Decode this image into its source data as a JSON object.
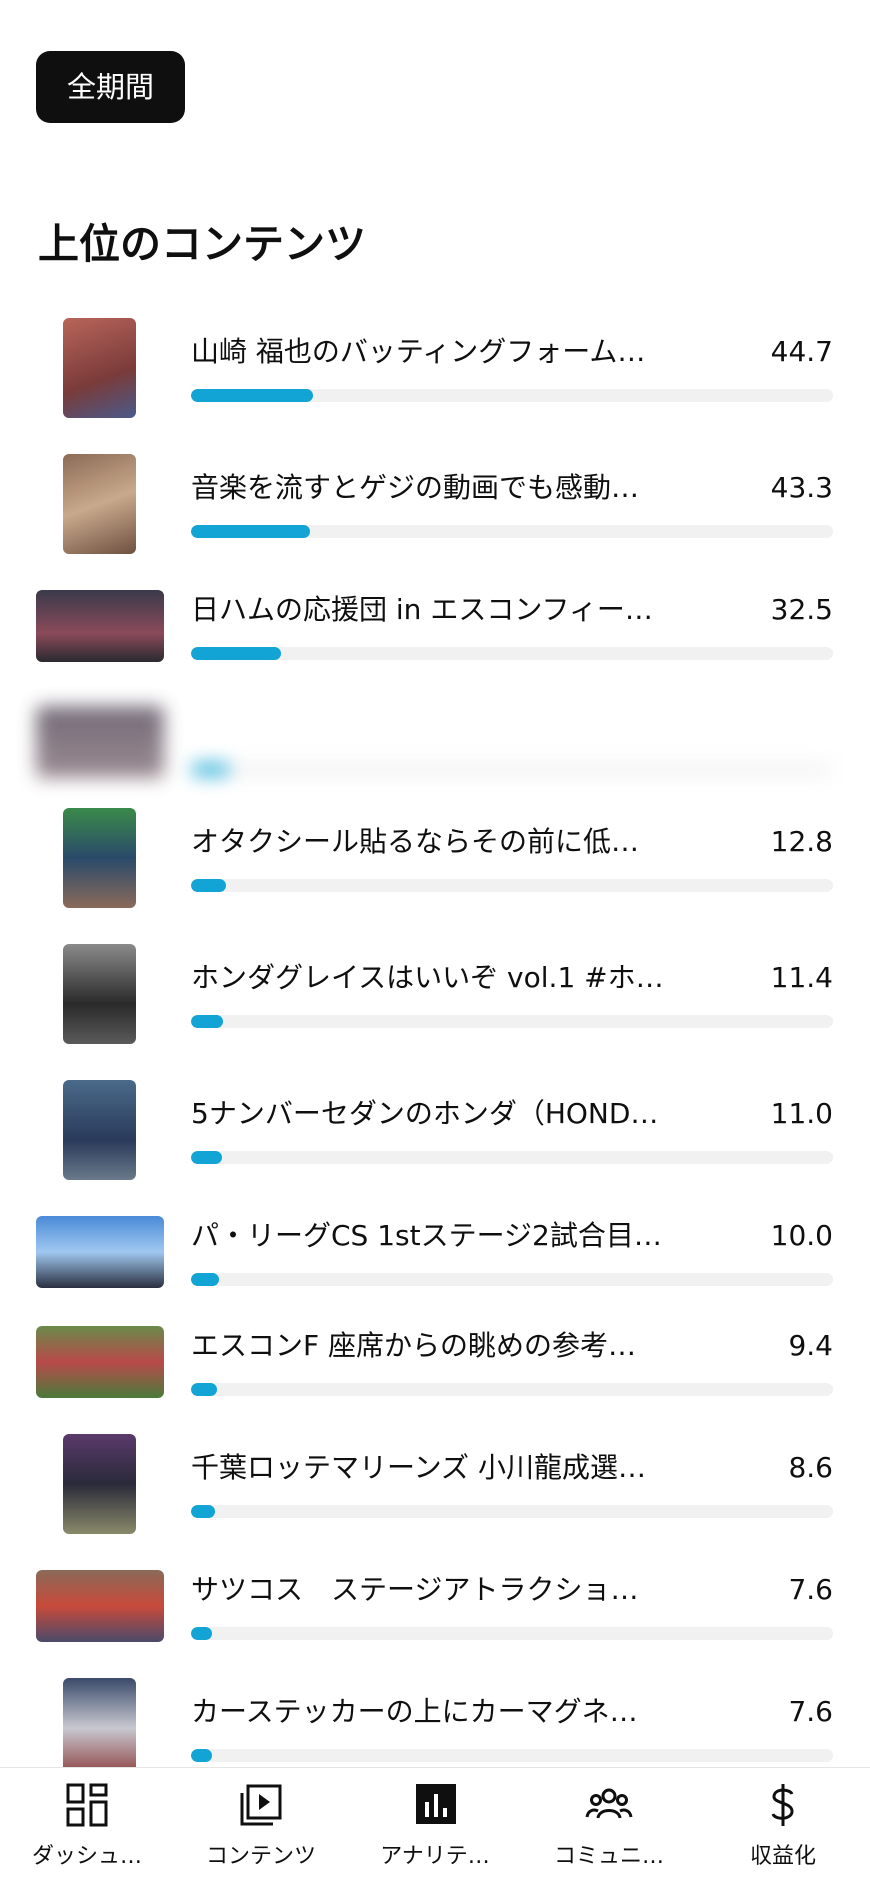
{
  "filter_chip": {
    "label": "全期間"
  },
  "section": {
    "title": "上位のコンテンツ"
  },
  "accent_color": "#11a4d4",
  "items": [
    {
      "title": "山崎 福也のバッティングフォーム…",
      "value": "44.7",
      "bar_fraction": 0.19,
      "thumb": "portrait",
      "blurred": false
    },
    {
      "title": "音楽を流すとゲジの動画でも感動…",
      "value": "43.3",
      "bar_fraction": 0.185,
      "thumb": "portrait",
      "blurred": false
    },
    {
      "title": "日ハムの応援団 in エスコンフィー…",
      "value": "32.5",
      "bar_fraction": 0.14,
      "thumb": "landscape",
      "blurred": false
    },
    {
      "title": "",
      "value": "",
      "bar_fraction": 0.06,
      "thumb": "landscape",
      "blurred": true
    },
    {
      "title": "オタクシール貼るならその前に低…",
      "value": "12.8",
      "bar_fraction": 0.055,
      "thumb": "portrait",
      "blurred": false
    },
    {
      "title": "ホンダグレイスはいいぞ vol.1 #ホ…",
      "value": "11.4",
      "bar_fraction": 0.05,
      "thumb": "portrait",
      "blurred": false
    },
    {
      "title": "5ナンバーセダンのホンダ（HOND…",
      "value": "11.0",
      "bar_fraction": 0.048,
      "thumb": "portrait",
      "blurred": false
    },
    {
      "title": "パ・リーグCS 1stステージ2試合目…",
      "value": "10.0",
      "bar_fraction": 0.043,
      "thumb": "landscape",
      "blurred": false
    },
    {
      "title": "エスコンF 座席からの眺めの参考…",
      "value": "9.4",
      "bar_fraction": 0.041,
      "thumb": "landscape",
      "blurred": false
    },
    {
      "title": "千葉ロッテマリーンズ 小川龍成選…",
      "value": "8.6",
      "bar_fraction": 0.037,
      "thumb": "portrait",
      "blurred": false
    },
    {
      "title": "サツコス　ステージアトラクショ…",
      "value": "7.6",
      "bar_fraction": 0.033,
      "thumb": "landscape",
      "blurred": false
    },
    {
      "title": "カーステッカーの上にカーマグネ…",
      "value": "7.6",
      "bar_fraction": 0.033,
      "thumb": "portrait",
      "blurred": false
    }
  ],
  "bottom_nav": [
    {
      "label": "ダッシュ…",
      "icon": "dashboard-icon",
      "active": false
    },
    {
      "label": "コンテンツ",
      "icon": "content-play-icon",
      "active": false
    },
    {
      "label": "アナリテ…",
      "icon": "analytics-icon",
      "active": true
    },
    {
      "label": "コミュニ…",
      "icon": "community-icon",
      "active": false
    },
    {
      "label": "収益化",
      "icon": "dollar-icon",
      "active": false
    }
  ]
}
